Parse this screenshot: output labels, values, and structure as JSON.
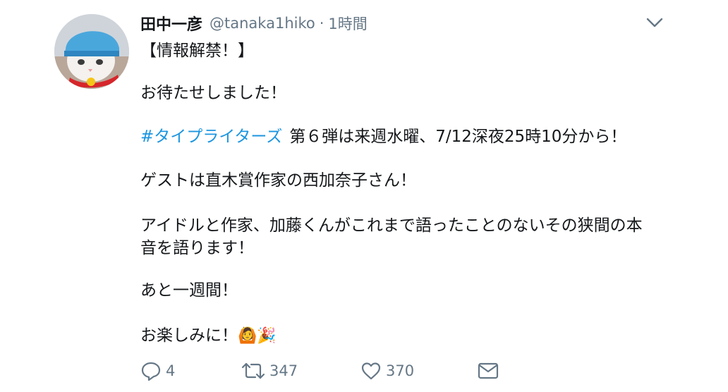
{
  "tweet": {
    "display_name": "田中一彦",
    "handle": "@tanaka1hiko",
    "separator": "·",
    "time": "1時間",
    "avatar_icon": "cat-avatar",
    "caret_icon": "chevron-down-icon",
    "lines": {
      "l1": "【情報解禁！】",
      "l2": "お待たせしました！",
      "l3_hashtag": "#タイプライターズ",
      "l3_rest": "第６弾は来週水曜、7/12深夜25時10分から！",
      "l4": "ゲストは直木賞作家の西加奈子さん！",
      "l5": "アイドルと作家、加藤くんがこれまで語ったことのないその狭間の本",
      "l6": "音を語ります！",
      "l7": "あと一週間！",
      "l8": "お楽しみに！",
      "emoji": "🙆🎉"
    },
    "actions": {
      "reply_icon": "reply-icon",
      "reply_count": "4",
      "retweet_icon": "retweet-icon",
      "retweet_count": "347",
      "like_icon": "heart-icon",
      "like_count": "370",
      "dm_icon": "envelope-icon"
    },
    "colors": {
      "hashtag": "#1b95e0",
      "secondary_text": "#657786",
      "primary_text": "#14171a"
    }
  }
}
